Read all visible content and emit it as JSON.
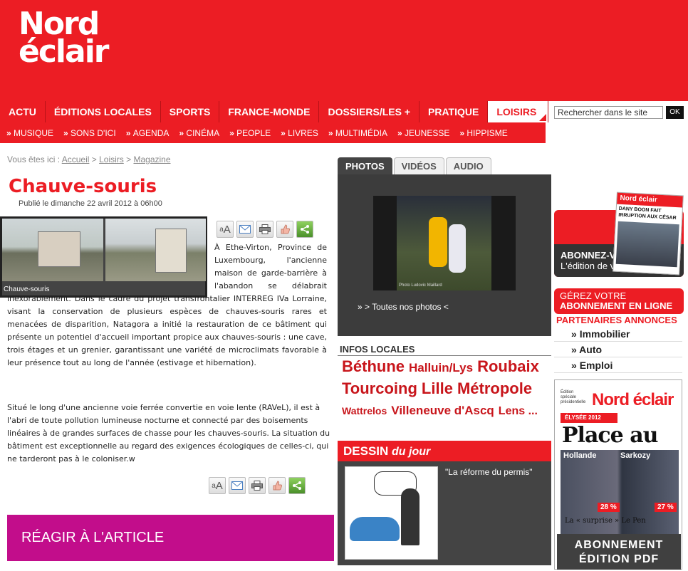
{
  "header": {
    "logo_line1": "Nord",
    "logo_line2": "éclair"
  },
  "nav": {
    "items": [
      "ACTU",
      "ÉDITIONS LOCALES",
      "SPORTS",
      "FRANCE-MONDE",
      "DOSSIERS/LES +",
      "PRATIQUE",
      "LOISIRS"
    ],
    "active": "LOISIRS",
    "sub_items": [
      "MUSIQUE",
      "SONS D'ICI",
      "AGENDA",
      "CINÉMA",
      "PEOPLE",
      "LIVRES",
      "MULTIMÉDIA",
      "JEUNESSE",
      "HIPPISME"
    ]
  },
  "search": {
    "value": "Rechercher dans le site",
    "button": "OK"
  },
  "breadcrumb": {
    "prefix": "Vous êtes ici :",
    "items": [
      "Accueil",
      "Loisirs",
      "Magazine"
    ]
  },
  "article": {
    "title": "Chauve-souris",
    "date": "Publié le dimanche 22 avril 2012 à 06h00",
    "photo_caption": "Chauve-souris",
    "lead": "À Ethe-Virton, Province de Luxembourg, l'ancienne maison de garde-barrière à l'abandon se délabrait inexorablement. Dans le cadre du projet transfrontalier INTERREG IVa Lorraine, visant la conservation de plusieurs espèces de chauves-souris rares et menacées de disparition, Natagora a initié la restauration de ce bâtiment qui présente un potentiel d'accueil important propice aux chauves-souris : une cave, trois étages et un grenier, garantissant une variété de microclimats favorable à leur présence tout au long de l'année (estivage et hibernation).",
    "body": "Situé le long d'une ancienne voie ferrée convertie en voie lente (RAVeL), il est à l'abri de toute pollution lumineuse nocturne et connecté par des boisements linéaires à de grandes surfaces de chasse pour les chauves-souris. La situation du bâtiment est exceptionnelle au regard des exigences écologiques de celles-ci, qui ne tarderont pas à le coloniser.w",
    "react_label": "RÉAGIR À L'ARTICLE"
  },
  "tools": {
    "font_small": "a",
    "font_big": "A",
    "share": "<"
  },
  "media": {
    "tabs": [
      "PHOTOS",
      "VIDÉOS",
      "AUDIO"
    ],
    "active_tab": "PHOTOS",
    "credit": "Photo Ludovic Maillard",
    "all_photos": "» > Toutes nos photos <"
  },
  "infos": {
    "header": "INFOS LOCALES",
    "cities": [
      {
        "name": "Béthune",
        "size": 22
      },
      {
        "name": "Halluin/Lys",
        "size": 17
      },
      {
        "name": "Roubaix",
        "size": 22
      },
      {
        "name": "Tourcoing",
        "size": 22
      },
      {
        "name": "Lille",
        "size": 22
      },
      {
        "name": "Métropole",
        "size": 22
      },
      {
        "name": "Wattrelos",
        "size": 14
      },
      {
        "name": "Villeneuve d'Ascq",
        "size": 17
      },
      {
        "name": "Lens ...",
        "size": 16
      }
    ]
  },
  "dessin": {
    "label": "DESSIN",
    "label2": "du jour",
    "caption": "\"La réforme du permis\""
  },
  "sidebar": {
    "abonnez_bold": "ABONNEZ-VOUS",
    "abonnez_rest": " à",
    "abonnez_line2": "L'édition de votre choix",
    "mini_paper_name": "Nord éclair",
    "mini_paper_headline": "DANY BOON FAIT IRRUPTION AUX CÉSAR",
    "gerez_line1": "GÉREZ VOTRE",
    "gerez_line2": "ABONNEMENT EN LIGNE",
    "partners_header": "PARTENAIRES ANNONCES",
    "partners": [
      "Immobilier",
      "Auto",
      "Emploi"
    ],
    "paper": {
      "name": "Nord éclair",
      "edition": "Édition spéciale présidentielle",
      "banner": "ÉLYSÉE 2012",
      "headline": "Place au duel",
      "left_name": "Hollande",
      "right_name": "Sarkozy",
      "left_pct": "28 %",
      "right_pct": "27 %",
      "sub": "La « surprise » Le Pen"
    },
    "pdf_line1": "ABONNEMENT",
    "pdf_line2": "ÉDITION PDF"
  },
  "colors": {
    "brand": "#ec1d24",
    "react": "#c20d8b",
    "dark": "#3c3c3c"
  }
}
